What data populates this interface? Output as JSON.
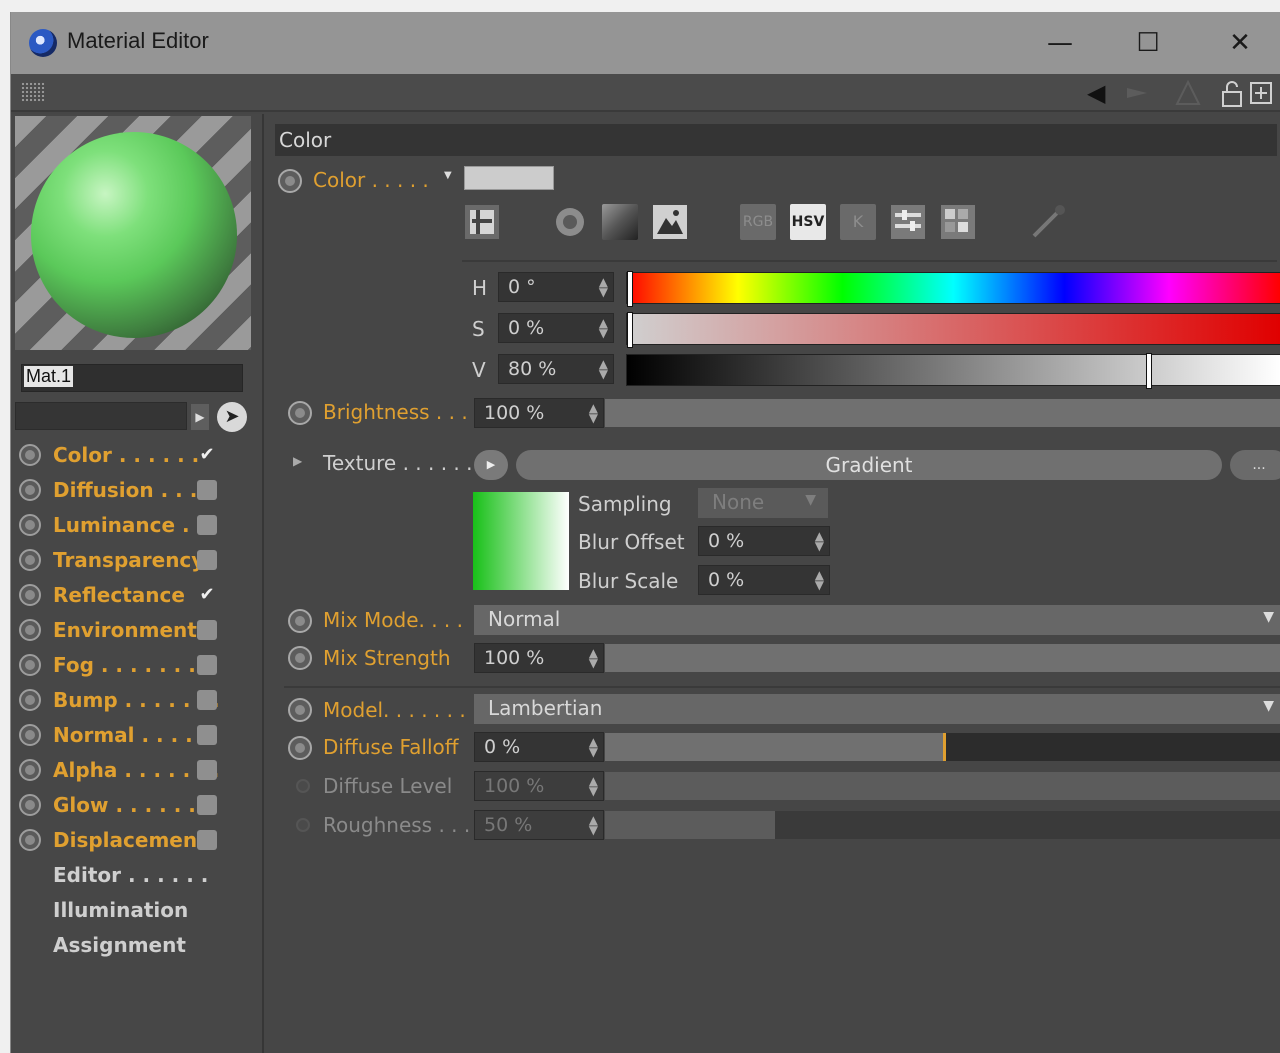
{
  "window": {
    "title": "Material Editor",
    "minimize": "—",
    "maximize": "☐",
    "close": "✕"
  },
  "toolbar": {
    "back": "◀",
    "lock": "🔓",
    "new_window": "⊞"
  },
  "material": {
    "name": "Mat.1"
  },
  "channels": [
    {
      "label": "Color . . . . . .",
      "checked": "✔"
    },
    {
      "label": "Diffusion . . .",
      "checked": ""
    },
    {
      "label": "Luminance . .",
      "checked": ""
    },
    {
      "label": "Transparency",
      "checked": ""
    },
    {
      "label": "Reflectance",
      "checked": "✔"
    },
    {
      "label": "Environment",
      "checked": ""
    },
    {
      "label": "Fog . . . . . . . .",
      "checked": ""
    },
    {
      "label": "Bump . . . . . . .",
      "checked": ""
    },
    {
      "label": "Normal . . . . .",
      "checked": ""
    },
    {
      "label": "Alpha . . . . . . .",
      "checked": ""
    },
    {
      "label": "Glow . . . . . . .",
      "checked": ""
    },
    {
      "label": "Displacement",
      "checked": ""
    }
  ],
  "extra_tabs": [
    "Editor . . . . . .",
    "Illumination",
    "Assignment"
  ],
  "section_title": "Color",
  "color": {
    "label": "Color . . . . .",
    "swatch": "#cccccc",
    "modes": {
      "rgb": "RGB",
      "hsv": "HSV",
      "k": "K"
    },
    "h_label": "H",
    "h_value": "0 °",
    "s_label": "S",
    "s_value": "0 %",
    "v_label": "V",
    "v_value": "80 %",
    "v_level": 0.8
  },
  "brightness": {
    "label": "Brightness . . .",
    "value": "100 %",
    "level": 1.0
  },
  "texture": {
    "label": "Texture . . . . . .",
    "name": "Gradient",
    "more": "...",
    "sampling_label": "Sampling",
    "sampling_value": "None",
    "blur_offset_label": "Blur Offset",
    "blur_offset_value": "0 %",
    "blur_scale_label": "Blur Scale",
    "blur_scale_value": "0 %"
  },
  "mix_mode": {
    "label": "Mix Mode. . . .",
    "value": "Normal"
  },
  "mix_strength": {
    "label": "Mix Strength",
    "value": "100 %",
    "level": 1.0
  },
  "model": {
    "label": "Model. . . . . . .",
    "value": "Lambertian"
  },
  "diffuse_falloff": {
    "label": "Diffuse Falloff",
    "value": "0 %",
    "level": 0.5
  },
  "diffuse_level": {
    "label": "Diffuse Level",
    "value": "100 %",
    "level": 1.0
  },
  "roughness": {
    "label": "Roughness . . .",
    "value": "50 %",
    "level": 0.25
  },
  "colors": {
    "accent": "#e0a030",
    "panel": "#464646",
    "field": "#343434"
  }
}
